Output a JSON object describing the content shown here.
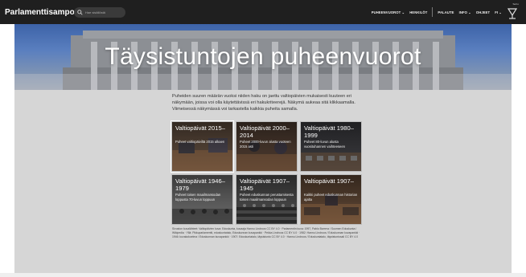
{
  "navbar": {
    "brand": "Parlamenttisampo",
    "search_placeholder": "Hae sisällöstä",
    "items": [
      "PUHEENVUOROT ⌄",
      "HENKILÖT",
      "PALAUTE",
      "INFO ⌄",
      "OHJEET",
      "FI ⌄"
    ],
    "logo_text": "SeCo"
  },
  "hero": {
    "title": "Täysistuntojen puheenvuorot"
  },
  "intro": "Puheiden suuren määrän vuoksi niiden haku on jaettu valtiopäivien mukaisesti kuuteen eri näkymään, joissa voi olla käytettävissä eri hakukriteerejä. Näkymä aukeaa sitä klikkaamalla. Viimeisessä näkymässä voi tarkastella kaikkia puheita samalla.",
  "cards": [
    {
      "title": "Valtiopäivät 2015–",
      "desc": "Puheet valtiopäiviltä 2015 alkaen"
    },
    {
      "title": "Valtiopäivät 2000–2014",
      "desc": "Puheet 2000-luvun alusta vuoteen 2015 asti"
    },
    {
      "title": "Valtiopäivät 1980–1999",
      "desc": "Puheet 80-luvun alusta vuosituhannen vaihteeseen"
    },
    {
      "title": "Valtiopäivät 1946–1979",
      "desc": "Puheet toisen maailmansodan loppusta 70-luvun loppuun"
    },
    {
      "title": "Valtiopäivät 1907–1945",
      "desc": "Puheet eduskunnan perustamisesta toisen maailmansodan loppuun"
    },
    {
      "title": "Valtiopäivät 1907–",
      "desc": "Kaikki puheet eduskunnan historian ajalta"
    }
  ],
  "credits": "Sivuston kuvalähteet: Valtiopäivien kuva: Eduskunta, kuvaaja Hannu Lindroos CC BY 4.0 · Parlamentin kuva: 1997, Pablo Barrera / Suomen Eduskunta / Wikipedia · Yllä: Pikkuparlamentti, eduskuntatalo, Eduskunnan kuvapankki · Pekka Lindroos CC BY 4.0 · 1982: Hannu Lindroos / Eduskunnan kuvapankki · 1946: kuvakokoelma / Eduskunnan kuvapankki · 1907: Eduskuntatalo, täysistunto CC BY 4.0 · Hannu Lindroos / Eduskuntatalo, täysistuntosali CC BY 4.0"
}
